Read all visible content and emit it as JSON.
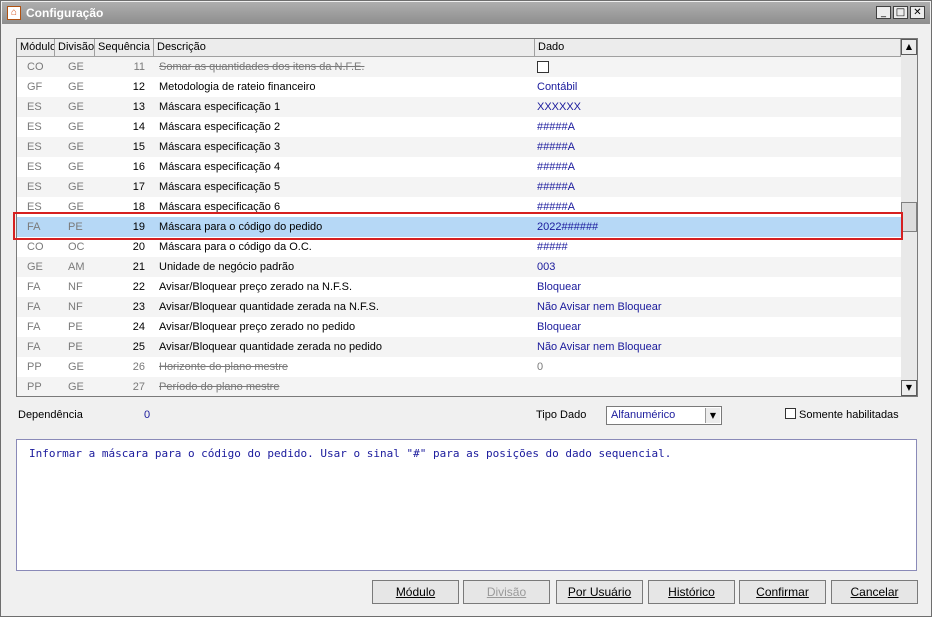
{
  "window": {
    "title": "Configuração",
    "minimize_glyph": "_",
    "maximize_glyph": "□",
    "close_glyph": "✕"
  },
  "grid": {
    "columns": [
      "Módulo",
      "Divisão",
      "Sequência",
      "Descrição",
      "Dado"
    ],
    "rows": [
      {
        "modulo": "CO",
        "divisao": "GE",
        "seq": "11",
        "desc": "Somar as quantidades dos itens da N.F.E.",
        "dado": "",
        "disabled": true,
        "checkbox": true
      },
      {
        "modulo": "GF",
        "divisao": "GE",
        "seq": "12",
        "desc": "Metodologia de rateio financeiro",
        "dado": "Contábil"
      },
      {
        "modulo": "ES",
        "divisao": "GE",
        "seq": "13",
        "desc": "Máscara especificação 1",
        "dado": "XXXXXX"
      },
      {
        "modulo": "ES",
        "divisao": "GE",
        "seq": "14",
        "desc": "Máscara especificação 2",
        "dado": "#####A"
      },
      {
        "modulo": "ES",
        "divisao": "GE",
        "seq": "15",
        "desc": "Máscara especificação 3",
        "dado": "#####A"
      },
      {
        "modulo": "ES",
        "divisao": "GE",
        "seq": "16",
        "desc": "Máscara especificação 4",
        "dado": "#####A"
      },
      {
        "modulo": "ES",
        "divisao": "GE",
        "seq": "17",
        "desc": "Máscara especificação 5",
        "dado": "#####A"
      },
      {
        "modulo": "ES",
        "divisao": "GE",
        "seq": "18",
        "desc": "Máscara especificação 6",
        "dado": "#####A"
      },
      {
        "modulo": "FA",
        "divisao": "PE",
        "seq": "19",
        "desc": "Máscara para o código do pedido",
        "dado": "2022######",
        "selected": true
      },
      {
        "modulo": "CO",
        "divisao": "OC",
        "seq": "20",
        "desc": "Máscara para o código da O.C.",
        "dado": "#####"
      },
      {
        "modulo": "GE",
        "divisao": "AM",
        "seq": "21",
        "desc": "Unidade de negócio padrão",
        "dado": "003"
      },
      {
        "modulo": "FA",
        "divisao": "NF",
        "seq": "22",
        "desc": "Avisar/Bloquear preço zerado na N.F.S.",
        "dado": "Bloquear"
      },
      {
        "modulo": "FA",
        "divisao": "NF",
        "seq": "23",
        "desc": "Avisar/Bloquear quantidade zerada na N.F.S.",
        "dado": "Não Avisar nem Bloquear"
      },
      {
        "modulo": "FA",
        "divisao": "PE",
        "seq": "24",
        "desc": "Avisar/Bloquear preço zerado no pedido",
        "dado": "Bloquear"
      },
      {
        "modulo": "FA",
        "divisao": "PE",
        "seq": "25",
        "desc": "Avisar/Bloquear quantidade zerada no pedido",
        "dado": "Não Avisar nem Bloquear"
      },
      {
        "modulo": "PP",
        "divisao": "GE",
        "seq": "26",
        "desc": "Horizonte do plano mestre",
        "dado": "0",
        "disabled": true
      },
      {
        "modulo": "PP",
        "divisao": "GE",
        "seq": "27",
        "desc": "Período do plano mestre",
        "dado": "",
        "disabled": true
      }
    ]
  },
  "dependencia": {
    "label": "Dependência",
    "value": "0"
  },
  "tipo_dado": {
    "label": "Tipo Dado",
    "value": "Alfanumérico"
  },
  "somente_habilitadas": {
    "label": "Somente habilitadas",
    "checked": false
  },
  "description": "Informar a máscara para o código do pedido. Usar o sinal \"#\" para as posições do dado sequencial.",
  "buttons": {
    "modulo": "Módulo",
    "divisao": "Divisão",
    "por_usuario": "Por Usuário",
    "historico": "Histórico",
    "confirmar": "Confirmar",
    "cancelar": "Cancelar"
  },
  "colors": {
    "title_bar": "#9e9e9e",
    "selected_row": "#b6d8f6",
    "highlight_outline": "#d62020",
    "data_text": "#1a1a9c",
    "disabled_text": "#7a7a7a"
  },
  "icons": {
    "app": "house-icon",
    "scroll_up": "arrow-up-icon",
    "scroll_down": "arrow-down-icon",
    "dropdown": "chevron-down-icon"
  }
}
